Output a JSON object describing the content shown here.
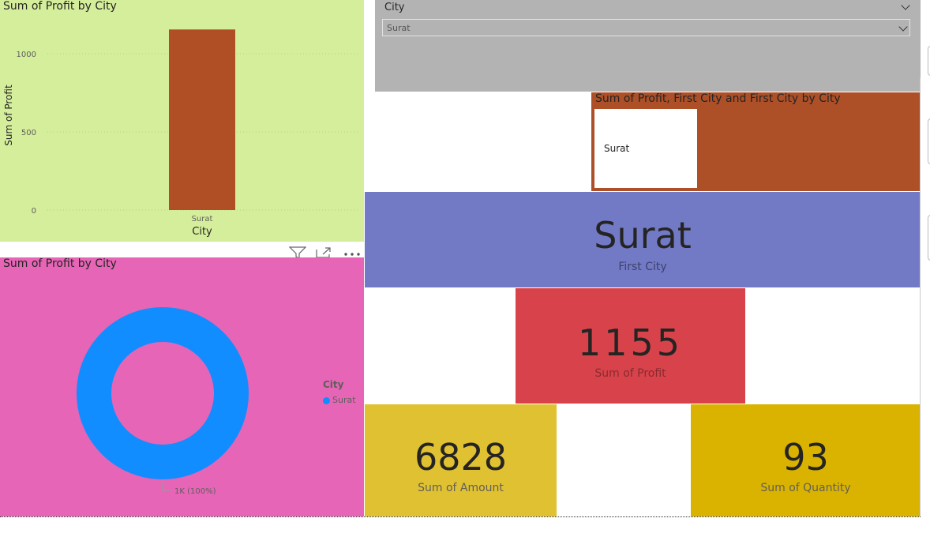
{
  "colors": {
    "bar_panel_bg": "#d5ee9b",
    "bar_fill": "#b04f26",
    "donut_panel_bg": "#e665b6",
    "donut_ring": "#118dff",
    "slicer_bg": "#b3b3b3",
    "table_panel_bg": "#ad5028",
    "first_city_bg": "#727ac6",
    "profit_card_bg": "#d8434b",
    "amount_card_bg": "#e0c131",
    "quantity_card_bg": "#d9b300"
  },
  "bar_chart": {
    "title": "Sum of Profit by City",
    "xlabel": "City",
    "ylabel": "Sum of Profit"
  },
  "donut_chart": {
    "title": "Sum of Profit by City",
    "legend_title": "City",
    "slice_label": "1K (100%)"
  },
  "visual_header_icons": [
    "filter-icon",
    "focus-mode-icon",
    "more-options-icon"
  ],
  "slicer": {
    "header": "City",
    "selected": "Surat"
  },
  "table_visual": {
    "title": "Sum of Profit, First City and First City by City",
    "cell": "Surat"
  },
  "first_city_card": {
    "value": "Surat",
    "label": "First City"
  },
  "profit_card": {
    "value": "1155",
    "label": "Sum of Profit"
  },
  "amount_card": {
    "value": "6828",
    "label": "Sum of Amount"
  },
  "quantity_card": {
    "value": "93",
    "label": "Sum of Quantity"
  },
  "chart_data": [
    {
      "type": "bar",
      "title": "Sum of Profit by City",
      "xlabel": "City",
      "ylabel": "Sum of Profit",
      "categories": [
        "Surat"
      ],
      "values": [
        1155
      ],
      "ylim": [
        0,
        1200
      ],
      "yticks": [
        0,
        500,
        1000
      ],
      "grid": true
    },
    {
      "type": "pie",
      "donut": true,
      "title": "Sum of Profit by City",
      "legend_title": "City",
      "legend": "right",
      "categories": [
        "Surat"
      ],
      "values": [
        1155
      ],
      "data_labels": [
        "1K (100%)"
      ]
    }
  ]
}
